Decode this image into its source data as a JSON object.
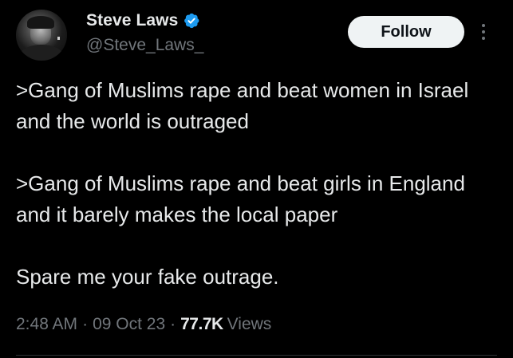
{
  "author": {
    "display_name": "Steve Laws",
    "handle": "@Steve_Laws_",
    "verified": true,
    "verified_color": "#1d9bf0"
  },
  "actions": {
    "follow_label": "Follow",
    "more_icon": "more-vertical-icon"
  },
  "tweet": {
    "paragraphs": [
      ">Gang of Muslims rape and beat women in Israel and the world is outraged",
      ">Gang of Muslims rape and beat girls in England and it barely makes the local paper",
      "Spare me your fake outrage."
    ]
  },
  "meta": {
    "time": "2:48 AM",
    "separator": "·",
    "date": "09 Oct 23",
    "views_count": "77.7K",
    "views_label": "Views"
  },
  "colors": {
    "background": "#000000",
    "text_primary": "#e7e9ea",
    "text_secondary": "#71767b",
    "button_bg": "#eff3f4",
    "divider": "#2f3336"
  }
}
